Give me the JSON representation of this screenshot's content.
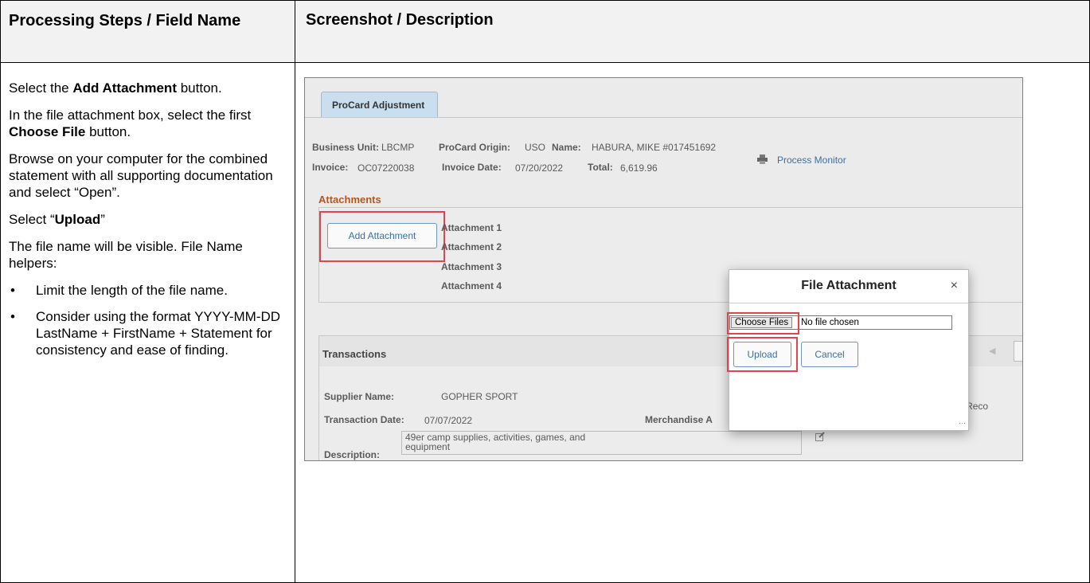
{
  "header": {
    "left": "Processing Steps / Field Name",
    "right": "Screenshot / Description"
  },
  "steps": {
    "p1_pre": "Select the ",
    "p1_bold": "Add Attachment",
    "p1_post": " button.",
    "p2_pre": "In the file attachment box, select the first ",
    "p2_bold": "Choose File",
    "p2_post": " button.",
    "p3": "Browse on your computer for the combined statement with all supporting documentation and select “Open”.",
    "p4_pre": "Select “",
    "p4_bold": "Upload",
    "p4_post": "”",
    "p5": "The file name will be visible. File Name helpers:",
    "bullets": [
      "Limit the length of the file name.",
      "Consider using the format YYYY-MM-DD LastName + FirstName + Statement for consistency and ease of finding."
    ],
    "bullet_char": "•"
  },
  "screenshot": {
    "tab": "ProCard Adjustment",
    "business_unit_label": "Business Unit:",
    "business_unit_value": "LBCMP",
    "origin_label": "ProCard Origin:",
    "origin_value": "USO",
    "name_label": "Name:",
    "name_value": "HABURA, MIKE  #017451692",
    "invoice_label": "Invoice:",
    "invoice_value": "OC07220038",
    "invoice_date_label": "Invoice Date:",
    "invoice_date_value": "07/20/2022",
    "total_label": "Total:",
    "total_value": "6,619.96",
    "process_monitor": "Process Monitor",
    "attachments_title": "Attachments",
    "add_attachment": "Add Attachment",
    "attachment_labels": [
      "Attachment 1",
      "Attachment 2",
      "Attachment 3",
      "Attachment 4"
    ],
    "transactions_title": "Transactions",
    "supplier_label": "Supplier Name:",
    "supplier_value": "GOPHER SPORT",
    "transaction_date_label": "Transaction Date:",
    "transaction_date_value": "07/07/2022",
    "merchandise_label": "Merchandise A",
    "description_label": "Description:",
    "description_value": "49er camp supplies, activities, games, and equipment",
    "reco_fragment": "☐ Reco",
    "modal": {
      "title": "File Attachment",
      "close": "×",
      "choose_files": "Choose Files",
      "no_file": "No file chosen",
      "upload": "Upload",
      "cancel": "Cancel"
    }
  }
}
